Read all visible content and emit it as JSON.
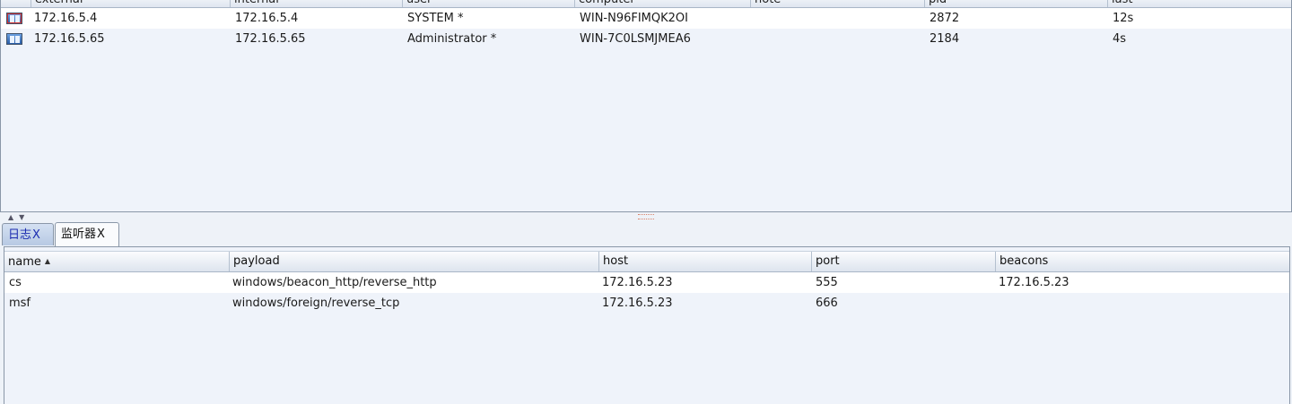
{
  "beacons_table": {
    "columns": [
      "external",
      "internal",
      "user",
      "computer",
      "note",
      "pid",
      "last"
    ],
    "rows": [
      {
        "icon": "windows-session-icon",
        "external": "172.16.5.4",
        "internal": "172.16.5.4",
        "user": "SYSTEM *",
        "computer": "WIN-N96FIMQK2OI",
        "note": "",
        "pid": "2872",
        "last": "12s"
      },
      {
        "icon": "windows-session-icon",
        "external": "172.16.5.65",
        "internal": "172.16.5.65",
        "user": "Administrator *",
        "computer": "WIN-7C0LSMJMEA6",
        "note": "",
        "pid": "2184",
        "last": "4s"
      }
    ]
  },
  "tabs": [
    {
      "label": "日志",
      "close": "X"
    },
    {
      "label": "监听器",
      "close": "X"
    }
  ],
  "listeners_table": {
    "columns": [
      "name",
      "payload",
      "host",
      "port",
      "beacons"
    ],
    "sort_indicator": "▲",
    "rows": [
      {
        "name": "cs",
        "payload": "windows/beacon_http/reverse_http",
        "host": "172.16.5.23",
        "port": "555",
        "beacons": "172.16.5.23"
      },
      {
        "name": "msf",
        "payload": "windows/foreign/reverse_tcp",
        "host": "172.16.5.23",
        "port": "666",
        "beacons": ""
      }
    ]
  },
  "colors": {
    "accent_tab_text": "#1b2bb0",
    "row_alt": "#ffffff",
    "panel_bg": "#eff3fa"
  }
}
